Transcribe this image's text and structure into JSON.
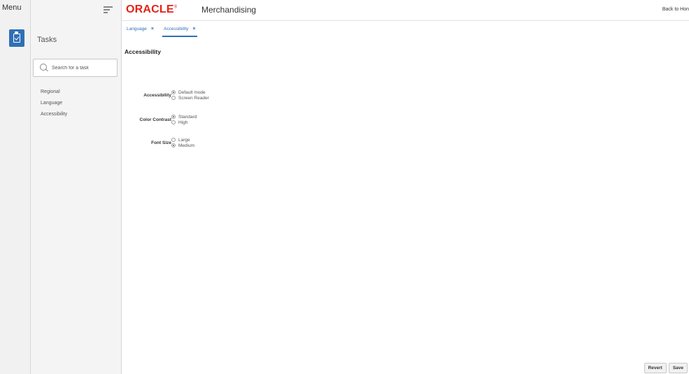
{
  "rail": {
    "menu_label": "Menu",
    "tasks_icon": "clipboard-check-icon"
  },
  "task_panel": {
    "title": "Tasks",
    "search_placeholder": "Search for a task",
    "items": [
      {
        "label": "Regional"
      },
      {
        "label": "Language"
      },
      {
        "label": "Accessibility"
      }
    ]
  },
  "header": {
    "brand_oracle": "ORACLE",
    "brand_app": "Merchandising",
    "back_link": "Back to Hon",
    "accent_color": "#e2231a"
  },
  "tabs": [
    {
      "label": "Language",
      "active": false
    },
    {
      "label": "Accessibility",
      "active": true
    }
  ],
  "page": {
    "title": "Accessibility",
    "fields": [
      {
        "label": "Accessibility",
        "options": [
          "Default mode",
          "Screen Reader"
        ],
        "selected": "Default mode"
      },
      {
        "label": "Color Contrast",
        "options": [
          "Standard",
          "High"
        ],
        "selected": "Standard"
      },
      {
        "label": "Font Size",
        "options": [
          "Large",
          "Medium"
        ],
        "selected": "Medium"
      }
    ]
  },
  "footer": {
    "revert_label": "Revert",
    "save_label": "Save"
  },
  "colors": {
    "primary": "#2f6fb6"
  }
}
